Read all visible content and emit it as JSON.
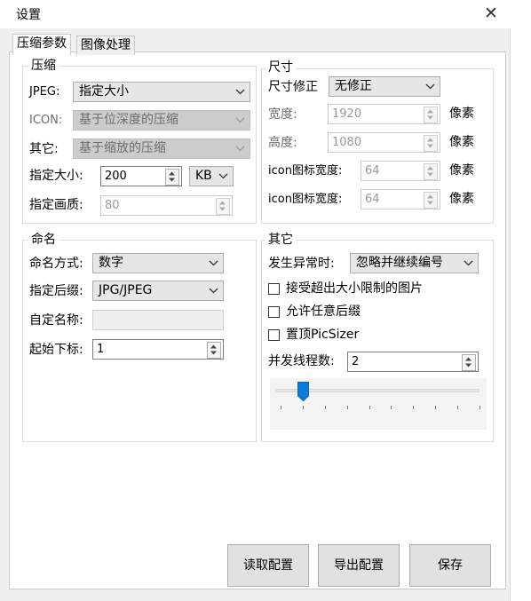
{
  "window": {
    "title": "设置"
  },
  "tabs": [
    {
      "label": "压缩参数"
    },
    {
      "label": "图像处理"
    }
  ],
  "compression": {
    "group_title": "压缩",
    "jpeg": {
      "label": "JPEG:",
      "value": "指定大小"
    },
    "icon": {
      "label": "ICON:",
      "value": "基于位深度的压缩"
    },
    "other": {
      "label": "其它:",
      "value": "基于缩放的压缩"
    },
    "size": {
      "label": "指定大小:",
      "value": "200",
      "unit": "KB"
    },
    "quality": {
      "label": "指定画质:",
      "value": "80"
    }
  },
  "dimension": {
    "group_title": "尺寸",
    "fix": {
      "label": "尺寸修正",
      "value": "无修正"
    },
    "width": {
      "label": "宽度:",
      "value": "1920",
      "unit": "像素"
    },
    "height": {
      "label": "高度:",
      "value": "1080",
      "unit": "像素"
    },
    "icon_width_1": {
      "label": "icon图标宽度:",
      "value": "64",
      "unit": "像素"
    },
    "icon_width_2": {
      "label": "icon图标宽度:",
      "value": "64",
      "unit": "像素"
    }
  },
  "naming": {
    "group_title": "命名",
    "mode": {
      "label": "命名方式:",
      "value": "数字"
    },
    "suffix": {
      "label": "指定后缀:",
      "value": "JPG/JPEG"
    },
    "custom": {
      "label": "自定名称:",
      "value": ""
    },
    "start_index": {
      "label": "起始下标:",
      "value": "1"
    }
  },
  "other": {
    "group_title": "其它",
    "on_error": {
      "label": "发生异常时:",
      "value": "忽略并继续编号"
    },
    "accept_oversize": {
      "label": "接受超出大小限制的图片",
      "checked": false
    },
    "allow_any_suffix": {
      "label": "允许任意后缀",
      "checked": false
    },
    "topmost": {
      "label": "置顶PicSizer",
      "checked": false
    },
    "threads": {
      "label": "并发线程数:",
      "value": "2"
    },
    "slider": {
      "value": 2,
      "min": 1,
      "max": 10
    }
  },
  "buttons": {
    "read": "读取配置",
    "export": "导出配置",
    "save": "保存"
  }
}
